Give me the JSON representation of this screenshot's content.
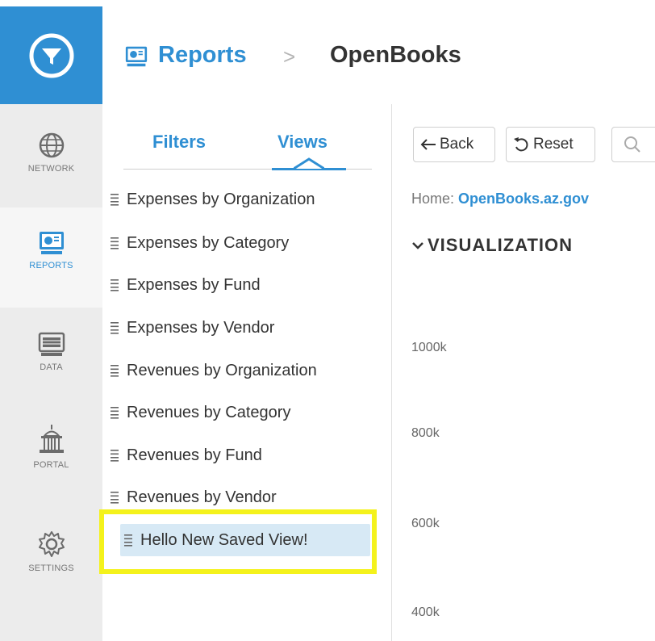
{
  "header": {
    "section": "Reports",
    "separator": ">",
    "current": "OpenBooks"
  },
  "rail": {
    "items": [
      {
        "label": "NETWORK",
        "icon": "globe-icon"
      },
      {
        "label": "REPORTS",
        "icon": "reports-icon",
        "active": true
      },
      {
        "label": "DATA",
        "icon": "data-icon"
      },
      {
        "label": "PORTAL",
        "icon": "portal-building-icon"
      },
      {
        "label": "SETTINGS",
        "icon": "gear-icon"
      }
    ]
  },
  "panel": {
    "tabs": {
      "filters": "Filters",
      "views": "Views"
    },
    "views": [
      "Expenses by Organization",
      "Expenses by Category",
      "Expenses by Fund",
      "Expenses by Vendor",
      "Revenues by Organization",
      "Revenues by Category",
      "Revenues by Fund",
      "Revenues by Vendor",
      "Hello New Saved View!"
    ]
  },
  "toolbar": {
    "back_label": "Back",
    "reset_label": "Reset"
  },
  "main": {
    "home_prefix": "Home:",
    "home_link": "OpenBooks.az.gov",
    "visualization_title": "VISUALIZATION",
    "y_ticks": [
      "1000k",
      "800k",
      "600k",
      "400k"
    ]
  },
  "colors": {
    "accent": "#2f8fd3",
    "highlight": "#f4f21c",
    "selected_bg": "#d7e9f5"
  }
}
